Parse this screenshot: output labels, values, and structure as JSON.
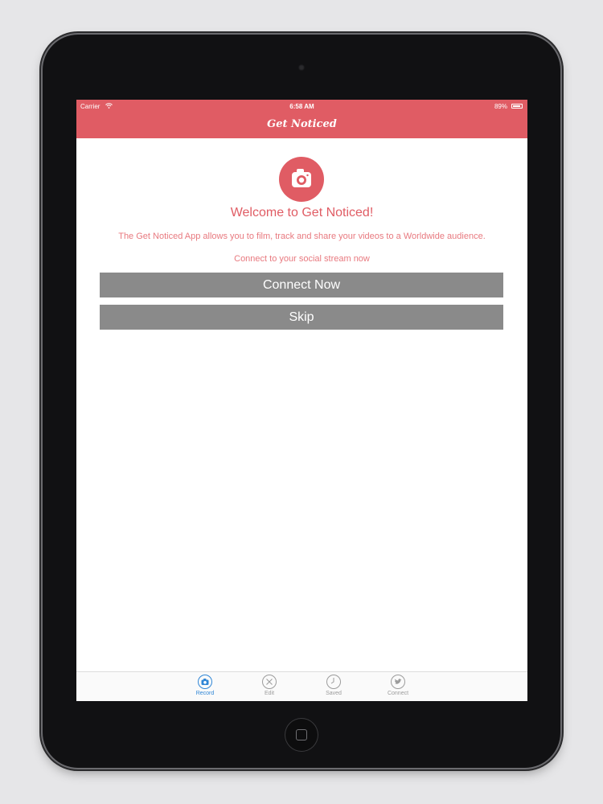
{
  "status_bar": {
    "carrier": "Carrier",
    "time": "6:58 AM",
    "battery": "89%",
    "battery_level": 0.89
  },
  "nav": {
    "title": "Get Noticed"
  },
  "welcome": {
    "icon": "camera-icon",
    "heading": "Welcome to Get Noticed!",
    "description": "The Get Noticed App allows you to film, track and share your videos to a Worldwide audience.",
    "prompt": "Connect to your social stream now"
  },
  "buttons": {
    "connect_now": "Connect Now",
    "skip": "Skip"
  },
  "tab_bar": {
    "tabs": [
      {
        "label": "Record",
        "icon": "camera-icon",
        "selected": true
      },
      {
        "label": "Edit",
        "icon": "close-icon",
        "selected": false
      },
      {
        "label": "Saved",
        "icon": "clock-icon",
        "selected": false
      },
      {
        "label": "Connect",
        "icon": "twitter-icon",
        "selected": false
      }
    ]
  },
  "colors": {
    "brand": "#e05c64",
    "button": "#8a8a8a",
    "tab_active": "#2f86d6",
    "tab_inactive": "#9c9c9c"
  }
}
